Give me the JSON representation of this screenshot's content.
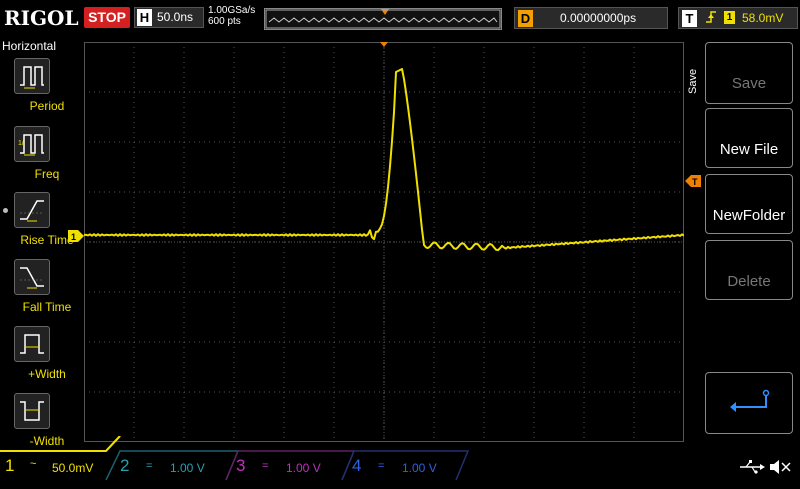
{
  "topbar": {
    "logo": "RIGOL",
    "run_state": "STOP",
    "horizontal_letter": "H",
    "timebase": "50.0ns",
    "sample_rate": "1.00GSa/s",
    "memory_depth": "600 pts",
    "delay_letter": "D",
    "delay_value": "0.00000000ps",
    "trigger_letter": "T",
    "trigger_source": "1",
    "trigger_level": "58.0mV"
  },
  "left_menu": {
    "title": "Horizontal",
    "items": [
      {
        "label": "Period"
      },
      {
        "label": "Freq"
      },
      {
        "label": "Rise Time"
      },
      {
        "label": "Fall Time"
      },
      {
        "label": "+Width"
      },
      {
        "label": "-Width"
      }
    ]
  },
  "right_menu": {
    "tab_label": "Save",
    "buttons": [
      {
        "label": "Save",
        "enabled": false
      },
      {
        "label": "New File",
        "enabled": true
      },
      {
        "label": "NewFolder",
        "enabled": true
      },
      {
        "label": "Delete",
        "enabled": false
      }
    ]
  },
  "channels": [
    {
      "num": "1",
      "scale": "50.0mV",
      "color": "#f0e000",
      "active": true
    },
    {
      "num": "2",
      "scale": "1.00 V",
      "color": "#27a0b0",
      "active": false
    },
    {
      "num": "3",
      "scale": "1.00 V",
      "color": "#c030c0",
      "active": false
    },
    {
      "num": "4",
      "scale": "1.00 V",
      "color": "#3060e0",
      "active": false
    }
  ],
  "markers": {
    "ch1_level": "1",
    "trigger_level": "T"
  },
  "colors": {
    "ch1": "#f0e000",
    "trigger": "#f08000",
    "grid": "#555555"
  }
}
